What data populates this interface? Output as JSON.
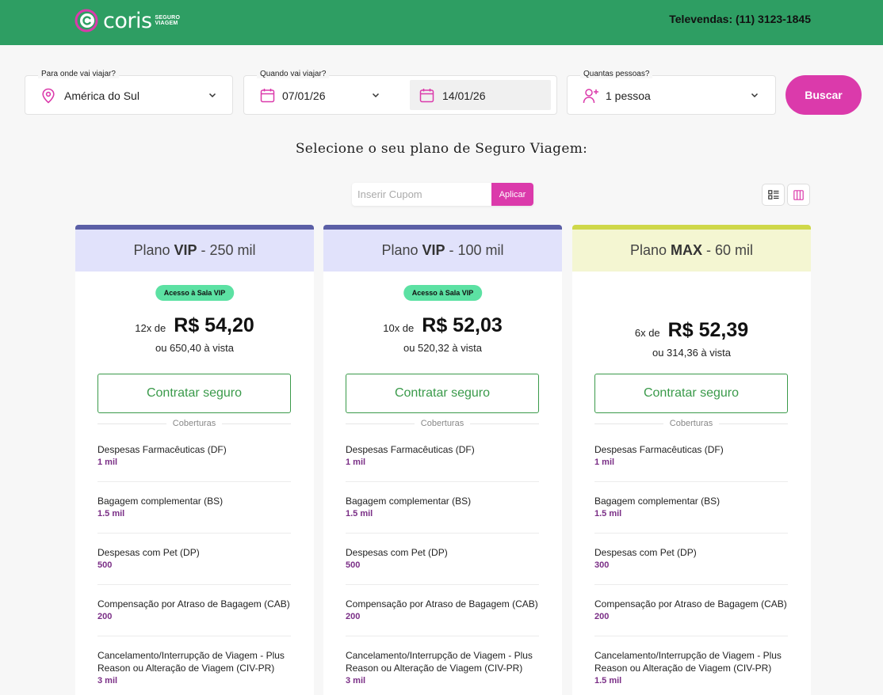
{
  "header": {
    "brand": "coris",
    "brand_tag_line1": "SEGURO",
    "brand_tag_line2": "VIAGEM",
    "televendas": "Televendas: (11) 3123-1845"
  },
  "search": {
    "destination_label": "Para onde vai viajar?",
    "destination_value": "América do Sul",
    "dates_label": "Quando vai viajar?",
    "date_start": "07/01/26",
    "date_end": "14/01/26",
    "people_label": "Quantas pessoas?",
    "people_value": "1 pessoa",
    "search_button": "Buscar"
  },
  "page": {
    "subtitle": "Selecione o seu plano de Seguro Viagem:"
  },
  "coupon": {
    "placeholder": "Inserir Cupom",
    "apply_button": "Aplicar"
  },
  "colors": {
    "header_green": "#2e9e63",
    "accent_pink": "#db3aab",
    "vip_top": "#5b5fa6",
    "vip_bg": "#e1e2fb",
    "max_top": "#cfd84a",
    "max_bg": "#f4f6d2",
    "coverage_value": "#7a2e86",
    "cta_green": "#3a9a4a"
  },
  "plans": [
    {
      "name_prefix": "Plano",
      "name_bold": "VIP",
      "name_suffix": "- 250 mil",
      "badge": "Acesso à Sala VIP",
      "installments": "12x de",
      "price": "R$ 54,20",
      "cash": "ou 650,40 à vista",
      "cta": "Contratar seguro",
      "coverages_title": "Coberturas",
      "coverages": [
        {
          "name": "Despesas Farmacêuticas (DF)",
          "value": "1 mil"
        },
        {
          "name": "Bagagem complementar (BS)",
          "value": "1.5 mil"
        },
        {
          "name": "Despesas com Pet (DP)",
          "value": "500"
        },
        {
          "name": "Compensação por Atraso de Bagagem (CAB)",
          "value": "200"
        },
        {
          "name": "Cancelamento/Interrupção de Viagem - Plus Reason ou Alteração de Viagem (CIV-PR)",
          "value": "3 mil"
        }
      ]
    },
    {
      "name_prefix": "Plano",
      "name_bold": "VIP",
      "name_suffix": "- 100 mil",
      "badge": "Acesso à Sala VIP",
      "installments": "10x de",
      "price": "R$ 52,03",
      "cash": "ou 520,32 à vista",
      "cta": "Contratar seguro",
      "coverages_title": "Coberturas",
      "coverages": [
        {
          "name": "Despesas Farmacêuticas (DF)",
          "value": "1 mil"
        },
        {
          "name": "Bagagem complementar (BS)",
          "value": "1.5 mil"
        },
        {
          "name": "Despesas com Pet (DP)",
          "value": "500"
        },
        {
          "name": "Compensação por Atraso de Bagagem (CAB)",
          "value": "200"
        },
        {
          "name": "Cancelamento/Interrupção de Viagem - Plus Reason ou Alteração de Viagem (CIV-PR)",
          "value": "3 mil"
        }
      ]
    },
    {
      "name_prefix": "Plano",
      "name_bold": "MAX",
      "name_suffix": "- 60 mil",
      "badge": "",
      "installments": "6x de",
      "price": "R$ 52,39",
      "cash": "ou 314,36 à vista",
      "cta": "Contratar seguro",
      "coverages_title": "Coberturas",
      "coverages": [
        {
          "name": "Despesas Farmacêuticas (DF)",
          "value": "1 mil"
        },
        {
          "name": "Bagagem complementar (BS)",
          "value": "1.5 mil"
        },
        {
          "name": "Despesas com Pet (DP)",
          "value": "300"
        },
        {
          "name": "Compensação por Atraso de Bagagem (CAB)",
          "value": "200"
        },
        {
          "name": "Cancelamento/Interrupção de Viagem - Plus Reason ou Alteração de Viagem (CIV-PR)",
          "value": "1.5 mil"
        }
      ]
    }
  ]
}
